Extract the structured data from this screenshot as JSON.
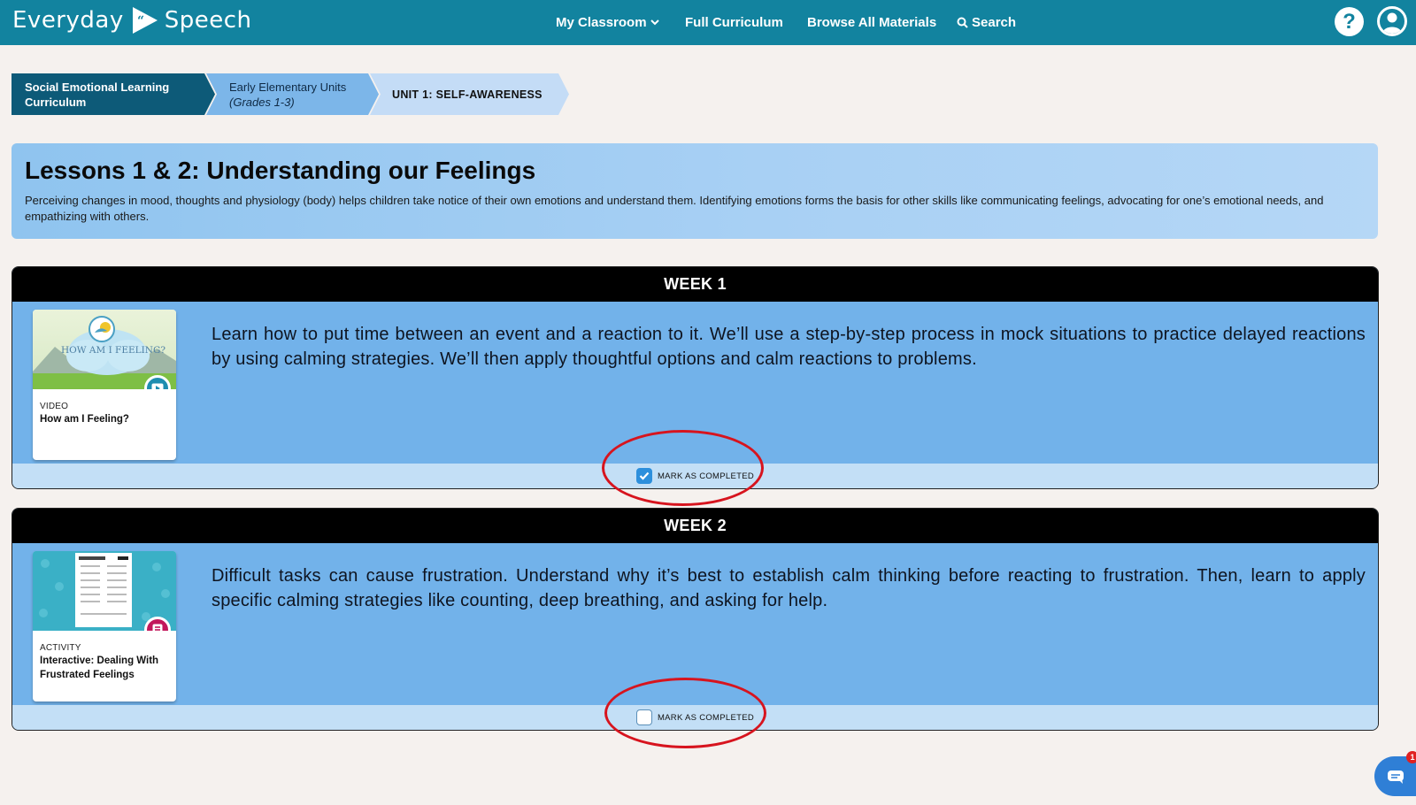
{
  "header": {
    "brand_left": "Everyday",
    "brand_right": "Speech",
    "nav": {
      "my_classroom": "My Classroom",
      "full_curriculum": "Full Curriculum",
      "browse_all": "Browse All Materials",
      "search": "Search"
    },
    "help_label": "?"
  },
  "breadcrumb": {
    "level1_line1": "Social Emotional Learning",
    "level1_line2": "Curriculum",
    "level2_line1": "Early Elementary Units",
    "level2_line2": "(Grades 1-3)",
    "level3": "UNIT 1: SELF-AWARENESS"
  },
  "lesson": {
    "title": "Lessons 1 & 2: Understanding our Feelings",
    "description": "Perceiving changes in mood, thoughts and physiology (body) helps children take notice of their own emotions and understand them. Identifying emotions forms the basis for other skills like communicating feelings, advocating for one’s emotional needs, and empathizing with others."
  },
  "weeks": [
    {
      "title": "WEEK 1",
      "material": {
        "type": "VIDEO",
        "title": "How am I Feeling?",
        "thumb_text": "HOW AM I FEELING?",
        "icon": "play-video-icon",
        "badge_color": "#1e8db0"
      },
      "description": "Learn how to put time between an event and a reaction to it. We’ll use a step-by-step process in mock situations to practice delayed reactions by using calming strategies. We’ll then apply thoughtful options and calm reactions to problems.",
      "completed": true,
      "mark_label": "MARK AS COMPLETED"
    },
    {
      "title": "WEEK 2",
      "material": {
        "type": "ACTIVITY",
        "title": "Interactive: Dealing With Frustrated Feelings",
        "icon": "document-activity-icon",
        "badge_color": "#c2185b"
      },
      "description": "Difficult tasks can cause frustration. Understand why it’s best to establish calm thinking before reacting to frustration. Then, learn to apply specific calming strategies like counting, deep breathing, and asking for help.",
      "completed": false,
      "mark_label": "MARK AS COMPLETED"
    }
  ],
  "chat": {
    "badge_count": "1"
  },
  "colors": {
    "header": "#12839f",
    "breadcrumb_dark": "#0d5a78",
    "week_body": "#72b2ea",
    "annotation": "#d7141e"
  }
}
